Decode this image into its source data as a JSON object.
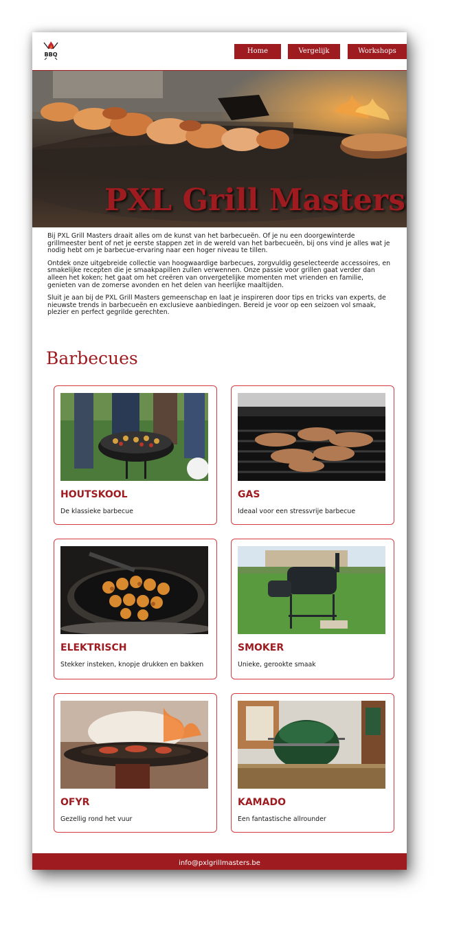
{
  "header": {
    "logo_text": "BBQ",
    "nav": [
      {
        "label": "Home"
      },
      {
        "label": "Vergelijk"
      },
      {
        "label": "Workshops"
      }
    ]
  },
  "hero": {
    "title": "PXL Grill Masters",
    "image": "grilled-skewers-photo"
  },
  "intro": {
    "paragraphs": [
      "Bij PXL Grill Masters draait alles om de kunst van het barbecueën. Of je nu een doorgewinterde grillmeester bent of net je eerste stappen zet in de wereld van het barbecueën, bij ons vind je alles wat je nodig hebt om je barbecue-ervaring naar een hoger niveau te tillen.",
      "Ontdek onze uitgebreide collectie van hoogwaardige barbecues, zorgvuldig geselecteerde accessoires, en smakelijke recepten die je smaakpapillen zullen verwennen. Onze passie voor grillen gaat verder dan alleen het koken; het gaat om het creëren van onvergetelijke momenten met vrienden en familie, genieten van de zomerse avonden en het delen van heerlijke maaltijden.",
      "Sluit je aan bij de PXL Grill Masters gemeenschap en laat je inspireren door tips en tricks van experts, de nieuwste trends in barbecueën en exclusieve aanbiedingen. Bereid je voor op een seizoen vol smaak, plezier en perfect gegrilde gerechten."
    ]
  },
  "section": {
    "title": "Barbecues"
  },
  "cards": [
    {
      "name": "HOUTSKOOL",
      "desc": "De klassieke barbecue",
      "image": "charcoal-kettle-photo"
    },
    {
      "name": "GAS",
      "desc": "Ideaal voor een stressvrije barbecue",
      "image": "gas-grill-photo"
    },
    {
      "name": "ELEKTRISCH",
      "desc": "Stekker insteken, knopje drukken en bakken",
      "image": "electric-grill-photo"
    },
    {
      "name": "SMOKER",
      "desc": "Unieke, gerookte smaak",
      "image": "smoker-photo"
    },
    {
      "name": "OFYR",
      "desc": "Gezellig rond het vuur",
      "image": "ofyr-fire-photo"
    },
    {
      "name": "KAMADO",
      "desc": "Een fantastische allrounder",
      "image": "kamado-photo"
    }
  ],
  "footer": {
    "email": "info@pxlgrillmasters.be"
  },
  "colors": {
    "brand_red": "#9e1b20",
    "card_border": "#d43a40"
  }
}
